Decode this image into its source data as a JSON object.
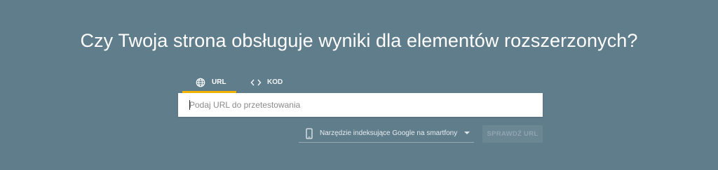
{
  "page": {
    "heading": "Czy Twoja strona obsługuje wyniki dla elementów rozszerzonych?"
  },
  "tabs": [
    {
      "label": "URL",
      "icon": "globe-icon",
      "active": true
    },
    {
      "label": "KOD",
      "icon": "code-icon",
      "active": false
    }
  ],
  "url_input": {
    "value": "",
    "placeholder": "Podaj URL do przetestowania"
  },
  "crawler_select": {
    "icon": "smartphone-icon",
    "selected": "Narzędzie indeksujące Google na smartfony"
  },
  "test_button": {
    "label": "SPRAWDŹ URL",
    "enabled": false
  },
  "colors": {
    "background": "#607d8b",
    "tab_indicator": "#f4b400",
    "text": "#ffffff"
  }
}
